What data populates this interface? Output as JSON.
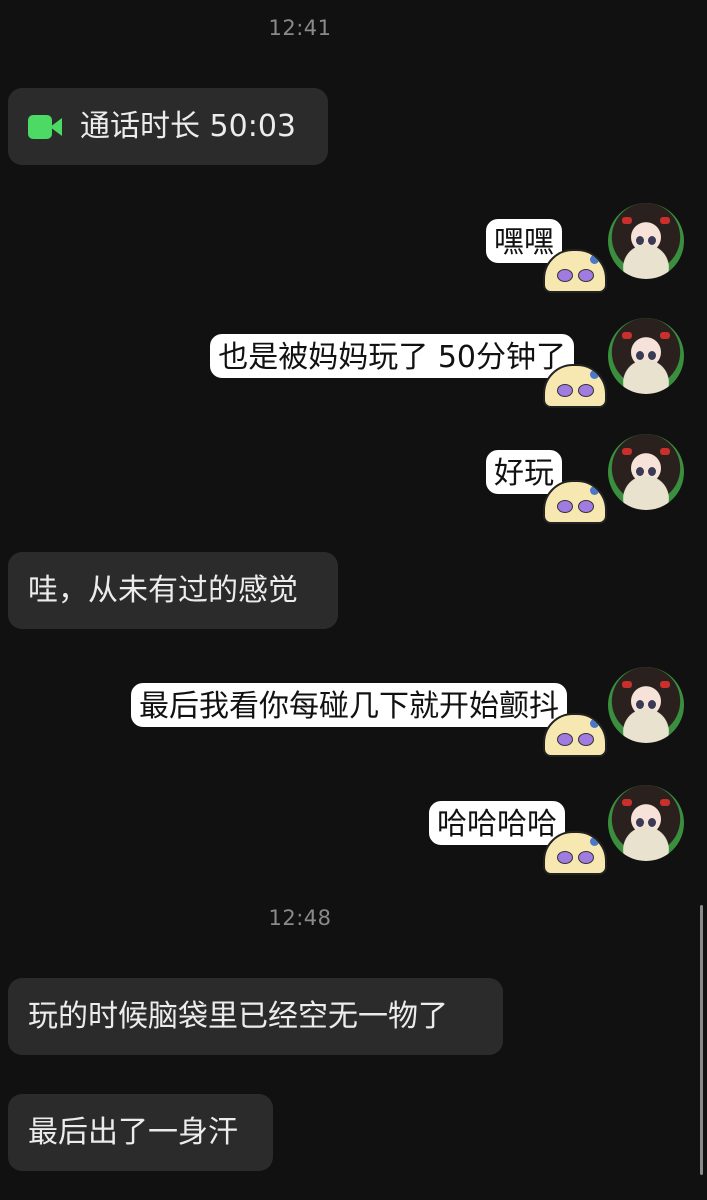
{
  "timestamps": [
    "12:41",
    "12:48"
  ],
  "call": {
    "icon": "video-call-icon",
    "label": "通话时长 50:03",
    "accent": "#4cd964"
  },
  "outgoing": [
    {
      "text": "嘿嘿"
    },
    {
      "text": "也是被妈妈玩了 50分钟了"
    },
    {
      "text": "好玩"
    },
    {
      "text": "最后我看你每碰几下就开始颤抖"
    },
    {
      "text": "哈哈哈哈"
    }
  ],
  "incoming": [
    {
      "text": "哇，从未有过的感觉"
    },
    {
      "text": "玩的时候脑袋里已经空无一物了"
    },
    {
      "text": "最后出了一身汗"
    }
  ],
  "colors": {
    "background": "#111111",
    "incoming_bubble": "#2b2b2b",
    "sticker_bubble": "#ffffff"
  }
}
